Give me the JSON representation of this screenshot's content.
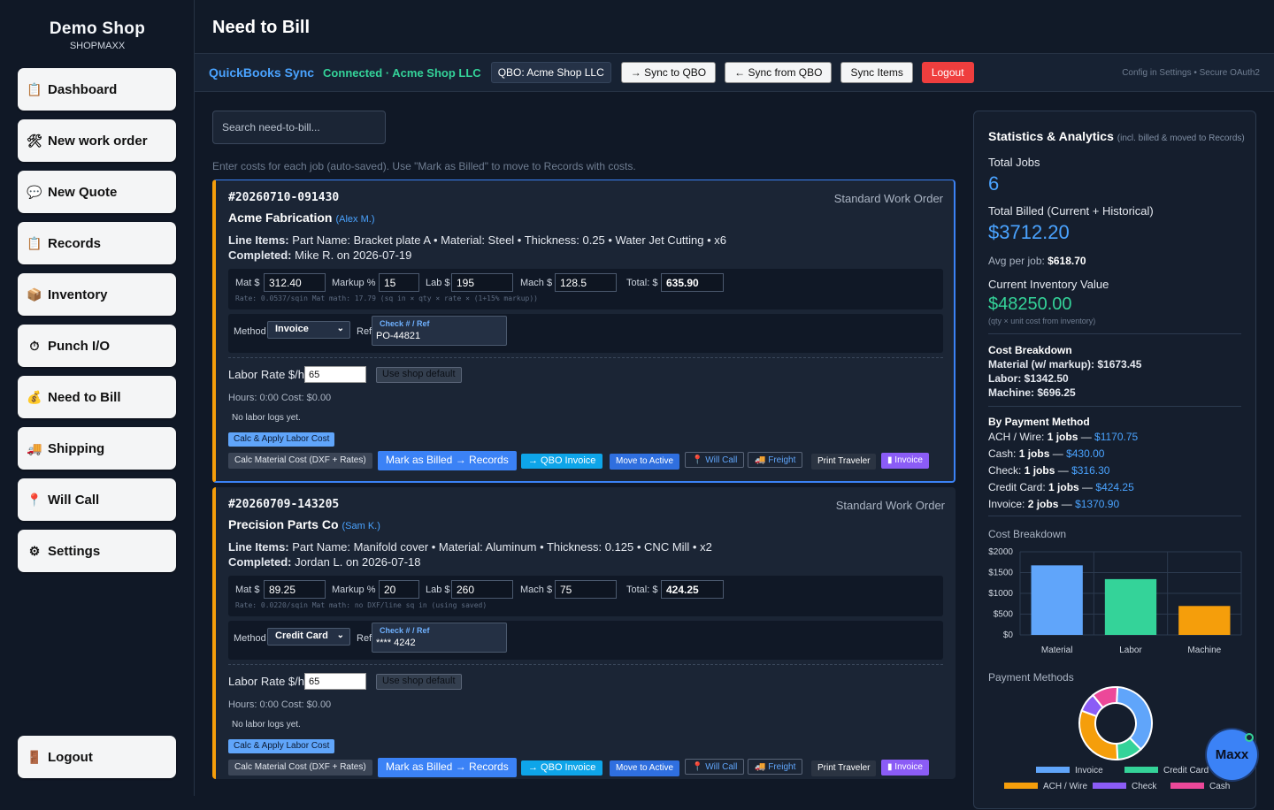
{
  "brand": {
    "name": "Demo Shop",
    "sub": "SHOPMAXX"
  },
  "nav": [
    {
      "label": "Dashboard",
      "icon": "clipboard-icon"
    },
    {
      "label": "New work order",
      "icon": "tools-icon"
    },
    {
      "label": "New Quote",
      "icon": "speech-bubble-icon"
    },
    {
      "label": "Records",
      "icon": "clipboard-icon"
    },
    {
      "label": "Inventory",
      "icon": "box-icon"
    },
    {
      "label": "Punch I/O",
      "icon": "stopwatch-icon"
    },
    {
      "label": "Need to Bill",
      "icon": "money-bag-icon"
    },
    {
      "label": "Shipping",
      "icon": "truck-icon"
    },
    {
      "label": "Will Call",
      "icon": "pin-icon"
    },
    {
      "label": "Settings",
      "icon": "gear-icon"
    }
  ],
  "logout_label": "Logout",
  "page_title": "Need to Bill",
  "qbo": {
    "title": "QuickBooks Sync",
    "status": "Connected · Acme Shop LLC",
    "chip": "QBO: Acme Shop LLC",
    "sync_to": "→ Sync to QBO",
    "sync_from": "← Sync from QBO",
    "sync_items": "Sync Items",
    "logout": "Logout",
    "note": "Config in Settings • Secure OAuth2"
  },
  "search": {
    "placeholder": "Search need-to-bill..."
  },
  "hint": "Enter costs for each job (auto-saved). Use \"Mark as Billed\" to move to Records with costs.",
  "labels": {
    "line_items": "Line Items:",
    "completed": "Completed:",
    "mat": "Mat $",
    "markup": "Markup %",
    "lab": "Lab $",
    "mach": "Mach $",
    "total": "Total: $",
    "method": "Method",
    "ref": "Ref",
    "check_ref": "Check # / Ref",
    "labor_rate": "Labor Rate $/hr",
    "use_default": "Use shop default",
    "calc_labor": "Calc & Apply Labor Cost",
    "calc_mat": "Calc Material Cost (DXF + Rates)",
    "mark_billed": "Mark as Billed → Records",
    "qbo_invoice": "→ QBO Invoice",
    "move_active": "Move to Active",
    "will_call": "Will Call",
    "freight": "Freight",
    "print_traveler": "Print Traveler",
    "invoice": "Invoice"
  },
  "jobs": [
    {
      "id": "#20260710-091430",
      "type": "Standard Work Order",
      "customer": "Acme Fabrication",
      "assignee": "(Alex M.)",
      "line_items": "Part Name: Bracket plate A • Material: Steel • Thickness: 0.25 • Water Jet Cutting • x6",
      "completed": "Mike R. on 2026-07-19",
      "mat": "312.40",
      "markup": "15",
      "lab": "195",
      "mach": "128.5",
      "total": "635.90",
      "rate": "Rate: 0.0537/sqin Mat math: 17.79 (sq in × qty × rate × (1+15% markup))",
      "method": "Invoice",
      "ref": "PO-44821",
      "labor_rate": "65",
      "hours": "Hours: 0:00 Cost: $0.00",
      "no_logs": "No labor logs yet."
    },
    {
      "id": "#20260709-143205",
      "type": "Standard Work Order",
      "customer": "Precision Parts Co",
      "assignee": "(Sam K.)",
      "line_items": "Part Name: Manifold cover • Material: Aluminum • Thickness: 0.125 • CNC Mill • x2",
      "completed": "Jordan L. on 2026-07-18",
      "mat": "89.25",
      "markup": "20",
      "lab": "260",
      "mach": "75",
      "total": "424.25",
      "rate": "Rate: 0.0220/sqin Mat math: no DXF/line sq in (using saved)",
      "method": "Credit Card",
      "ref": "**** 4242",
      "labor_rate": "65",
      "hours": "Hours: 0:00 Cost: $0.00",
      "no_logs": "No labor logs yet."
    }
  ],
  "stats": {
    "title": "Statistics & Analytics",
    "title_note": "(incl. billed & moved to Records)",
    "total_jobs_label": "Total Jobs",
    "total_jobs": "6",
    "total_billed_label": "Total Billed (Current + Historical)",
    "total_billed": "$3712.20",
    "avg_label": "Avg per job:",
    "avg": "$618.70",
    "inv_label": "Current Inventory Value",
    "inv_value": "$48250.00",
    "inv_note": "(qty × unit cost from inventory)",
    "cost_breakdown_label": "Cost Breakdown",
    "material": "Material (w/ markup): $1673.45",
    "labor": "Labor: $1342.50",
    "machine": "Machine: $696.25",
    "by_method_label": "By Payment Method",
    "methods": [
      {
        "name": "ACH / Wire:",
        "count": "1 jobs",
        "amount": "$1170.75"
      },
      {
        "name": "Cash:",
        "count": "1 jobs",
        "amount": "$430.00"
      },
      {
        "name": "Check:",
        "count": "1 jobs",
        "amount": "$316.30"
      },
      {
        "name": "Credit Card:",
        "count": "1 jobs",
        "amount": "$424.25"
      },
      {
        "name": "Invoice:",
        "count": "2 jobs",
        "amount": "$1370.90"
      }
    ],
    "bar_title": "Cost Breakdown",
    "pie_title": "Payment Methods"
  },
  "chart_data": [
    {
      "type": "bar",
      "title": "Cost Breakdown",
      "categories": [
        "Material",
        "Labor",
        "Machine"
      ],
      "values": [
        1673.45,
        1342.5,
        696.25
      ],
      "colors": [
        "#60a5fa",
        "#34d399",
        "#f59e0b"
      ],
      "yticks": [
        "$0",
        "$500",
        "$1000",
        "$1500",
        "$2000"
      ],
      "ylim": [
        0,
        2000
      ],
      "grid": true
    },
    {
      "type": "pie",
      "title": "Payment Methods",
      "labels": [
        "Invoice",
        "Credit Card",
        "ACH / Wire",
        "Check",
        "Cash"
      ],
      "values": [
        1370.9,
        424.25,
        1170.75,
        316.3,
        430.0
      ],
      "colors": [
        "#60a5fa",
        "#34d399",
        "#f59e0b",
        "#8b5cf6",
        "#ec4899"
      ],
      "legend": "bottom"
    }
  ],
  "maxx_label": "Maxx"
}
